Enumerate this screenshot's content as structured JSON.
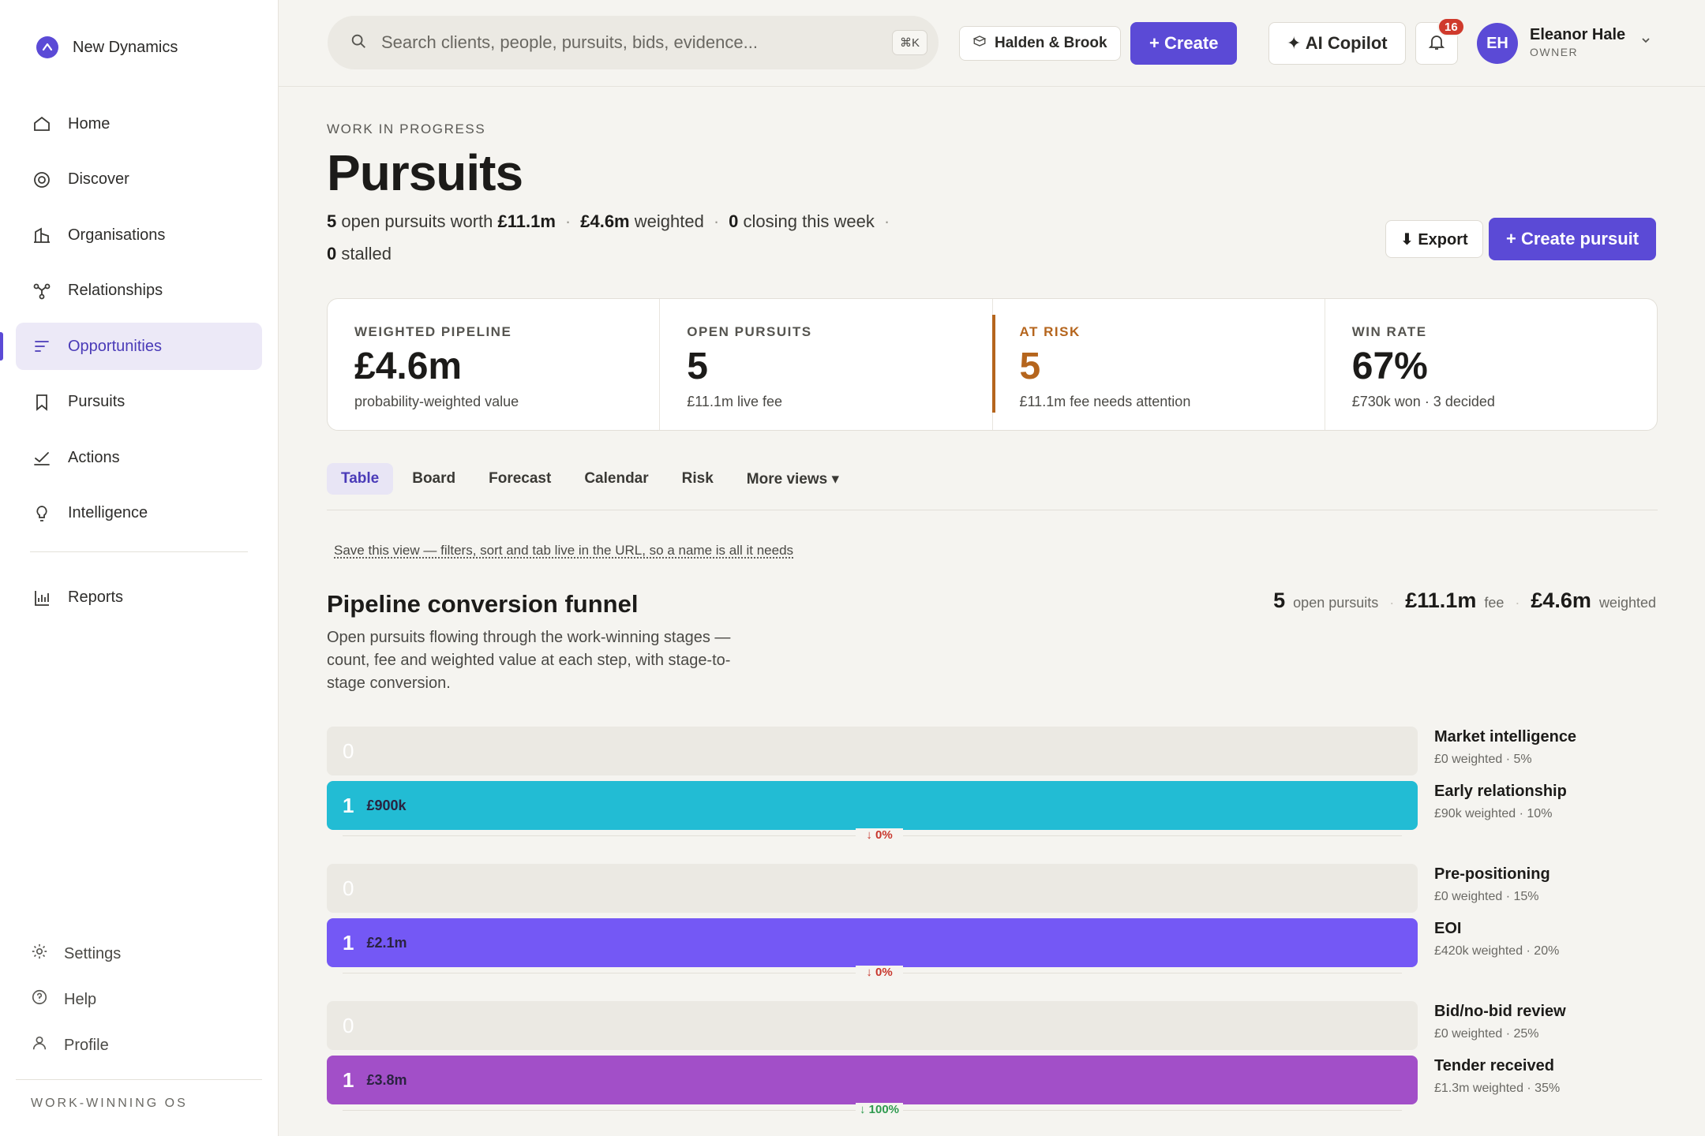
{
  "app": {
    "name": "New Dynamics",
    "footer_label": "WORK-WINNING OS"
  },
  "sidebar": {
    "items": [
      {
        "label": "Home",
        "icon": "home-icon"
      },
      {
        "label": "Discover",
        "icon": "discover-icon"
      },
      {
        "label": "Organisations",
        "icon": "building-icon"
      },
      {
        "label": "Relationships",
        "icon": "network-icon"
      },
      {
        "label": "Opportunities",
        "icon": "list-icon",
        "active": true
      },
      {
        "label": "Pursuits",
        "icon": "bookmark-icon"
      },
      {
        "label": "Actions",
        "icon": "check-icon"
      },
      {
        "label": "Intelligence",
        "icon": "bulb-icon"
      },
      {
        "label": "Reports",
        "icon": "bar-chart-icon"
      }
    ],
    "footer_items": [
      {
        "label": "Settings",
        "icon": "gear-icon"
      },
      {
        "label": "Help",
        "icon": "help-icon"
      },
      {
        "label": "Profile",
        "icon": "user-icon"
      }
    ]
  },
  "topbar": {
    "search_placeholder": "Search clients, people, pursuits, bids, evidence...",
    "search_shortcut": "⌘K",
    "workspace": "Halden & Brook",
    "create_label": "+ Create",
    "copilot_label": "✦ AI Copilot",
    "notifications_count": "16",
    "user_initials": "EH",
    "user_name": "Eleanor Hale",
    "user_role": "OWNER"
  },
  "page": {
    "eyebrow": "WORK IN PROGRESS",
    "title": "Pursuits",
    "summary": {
      "open_count": "5",
      "open_text": "open pursuits worth",
      "open_value": "£11.1m",
      "weighted_value": "£4.6m",
      "weighted_text": "weighted",
      "closing_count": "0",
      "closing_text": "closing this week",
      "stalled_count": "0",
      "stalled_text": "stalled"
    },
    "export_label": "⬇ Export",
    "create_pursuit_label": "+ Create pursuit"
  },
  "kpis": [
    {
      "label": "WEIGHTED PIPELINE",
      "value": "£4.6m",
      "sub": "probability-weighted value"
    },
    {
      "label": "OPEN PURSUITS",
      "value": "5",
      "sub": "£11.1m live fee"
    },
    {
      "label": "AT RISK",
      "value": "5",
      "sub": "£11.1m fee needs attention"
    },
    {
      "label": "WIN RATE",
      "value": "67%",
      "sub": "£730k won · 3 decided"
    }
  ],
  "tabs": [
    "Table",
    "Board",
    "Forecast",
    "Calendar",
    "Risk",
    "More views ▾"
  ],
  "save_view": "Save this view — filters, sort and tab live in the URL, so a name is all it needs",
  "funnel": {
    "title": "Pipeline conversion funnel",
    "description": "Open pursuits flowing through the work-winning stages — count, fee and weighted value at each step, with stage-to-stage conversion.",
    "stats": {
      "open_num": "5",
      "open_label": "open pursuits",
      "fee_num": "£11.1m",
      "fee_label": "fee",
      "weighted_num": "£4.6m",
      "weighted_label": "weighted"
    },
    "stages": [
      {
        "name": "Market intelligence",
        "meta": "£0 weighted · 5%",
        "count": "0",
        "fee": "",
        "color": ""
      },
      {
        "name": "Early relationship",
        "meta": "£90k weighted · 10%",
        "count": "1",
        "fee": "£900k",
        "color": "#22bcd4"
      },
      {
        "name": "Pre-positioning",
        "meta": "£0 weighted · 15%",
        "count": "0",
        "fee": "",
        "color": ""
      },
      {
        "name": "EOI",
        "meta": "£420k weighted · 20%",
        "count": "1",
        "fee": "£2.1m",
        "color": "#7458f5"
      },
      {
        "name": "Bid/no-bid review",
        "meta": "£0 weighted · 25%",
        "count": "0",
        "fee": "",
        "color": ""
      },
      {
        "name": "Tender received",
        "meta": "£1.3m weighted · 35%",
        "count": "1",
        "fee": "£3.8m",
        "color": "#a24fc8"
      }
    ],
    "conversions": [
      {
        "text": "↓ 0%",
        "dir": "down"
      },
      {
        "text": "↓ 0%",
        "dir": "down"
      },
      {
        "text": "↓ 100%",
        "dir": "up"
      }
    ]
  }
}
